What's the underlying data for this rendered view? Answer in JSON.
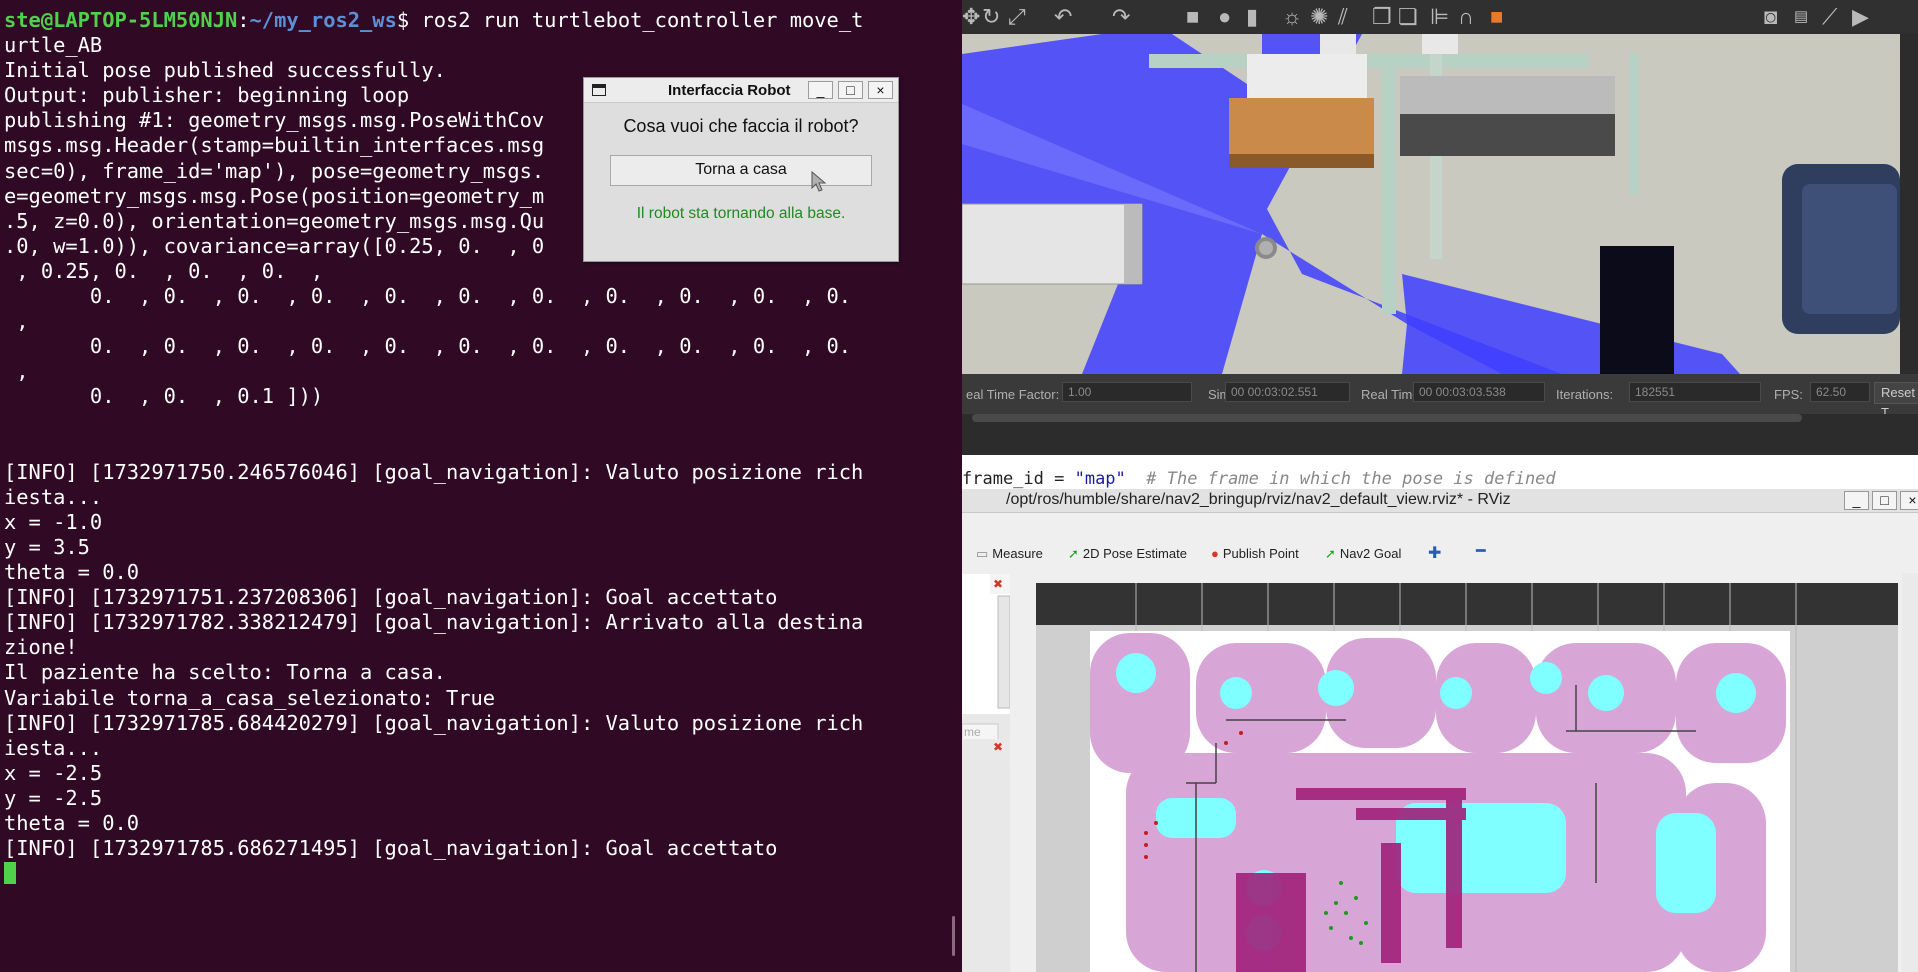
{
  "terminal": {
    "prompt_user": "ste@LAPTOP-5LM50NJN",
    "prompt_colon": ":",
    "prompt_path": "~/my_ros2_ws",
    "prompt_dollar": "$ ",
    "command": "ros2 run turtlebot_controller move_t\nurtle_AB",
    "output": "Initial pose published successfully.\nOutput: publisher: beginning loop\npublishing #1: geometry_msgs.msg.PoseWithCov                        d_\nmsgs.msg.Header(stamp=builtin_interfaces.msg                       no\nsec=0), frame_id='map'), pose=geometry_msgs.                       os\ne=geometry_msgs.msg.Pose(position=geometry_m                       -2\n.5, z=0.0), orientation=geometry_msgs.msg.Qu                       =0\n.0, w=1.0)), covariance=array([0.25, 0.  , 0                       .\n , 0.25, 0.  , 0.  , 0.  ,\n       0.  , 0.  , 0.  , 0.  , 0.  , 0.  , 0.  , 0.  , 0.  , 0.  , 0.\n ,\n       0.  , 0.  , 0.  , 0.  , 0.  , 0.  , 0.  , 0.  , 0.  , 0.  , 0.\n ,\n       0.  , 0.  , 0.1 ]))\n\n\n[INFO] [1732971750.246576046] [goal_navigation]: Valuto posizione rich\niesta...\nx = -1.0\ny = 3.5\ntheta = 0.0\n[INFO] [1732971751.237208306] [goal_navigation]: Goal accettato\n[INFO] [1732971782.338212479] [goal_navigation]: Arrivato alla destina\nzione!\nIl paziente ha scelto: Torna a casa.\nVariabile torna_a_casa_selezionato: True\n[INFO] [1732971785.684420279] [goal_navigation]: Valuto posizione rich\niesta...\nx = -2.5\ny = -2.5\ntheta = 0.0\n[INFO] [1732971785.686271495] [goal_navigation]: Goal accettato\n"
  },
  "dialog": {
    "title": "Interfaccia Robot",
    "minimize": "_",
    "maximize": "□",
    "close": "×",
    "question": "Cosa vuoi che faccia il robot?",
    "button": "Torna a casa",
    "status": "Il robot sta tornando alla base.",
    "status_color": "#1f8a1f"
  },
  "gazebo": {
    "toolbar_icons": [
      "move-icon",
      "rotate-icon",
      "scale-icon",
      "undo-icon",
      "redo-icon",
      "box-icon",
      "sphere-icon",
      "cylinder-icon",
      "sun-light-icon",
      "point-light-icon",
      "spot-light-icon",
      "copy-icon",
      "paste-icon",
      "align-icon",
      "snap-icon",
      "orange-cube-icon",
      "screenshot-icon",
      "log-icon",
      "plot-icon",
      "video-icon"
    ],
    "status": {
      "rtf_label": "eal Time Factor:",
      "rtf_value": "1.00",
      "sim_label": "Sim Time:",
      "sim_value": "00 00:03:02.551",
      "real_label": "Real Time:",
      "real_value": "00 00:03:03.538",
      "iter_label": "Iterations:",
      "iter_value": "182551",
      "fps_label": "FPS:",
      "fps_value": "62.50",
      "reset": "Reset T"
    }
  },
  "code_strip": {
    "code": "frame_id = ",
    "string": "\"map\"",
    "comment": "  # The frame in which the pose is defined"
  },
  "rviz": {
    "title": "/opt/ros/humble/share/nav2_bringup/rviz/nav2_default_view.rviz* - RViz",
    "tools": [
      "Measure",
      "2D Pose Estimate",
      "Publish Point",
      "Nav2 Goal"
    ],
    "panel_field_placeholder": "me",
    "minimize": "_",
    "maximize": "□",
    "close": "×"
  }
}
